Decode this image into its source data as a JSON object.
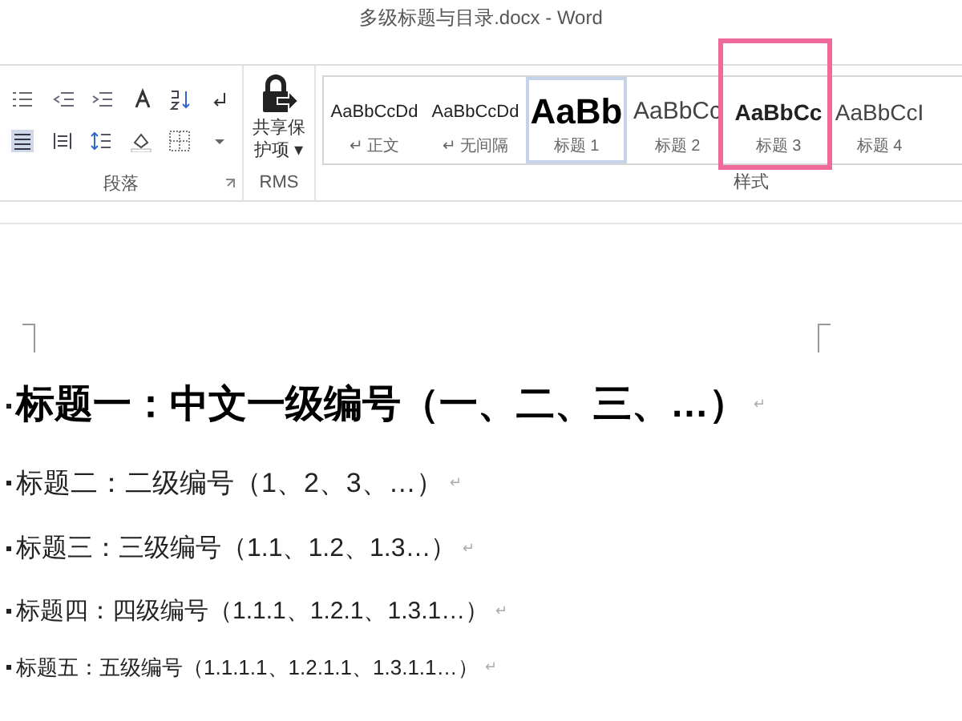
{
  "window": {
    "title": "多级标题与目录.docx - Word"
  },
  "ribbon": {
    "paragraph_group": {
      "label": "段落"
    },
    "rms_group": {
      "button": "共享保护项 ▾",
      "label": "RMS"
    },
    "styles_group": {
      "label": "样式",
      "styles": [
        {
          "preview": "AaBbCcDd",
          "label": "↵ 正文",
          "kind": "body",
          "selected": false,
          "highlighted": false
        },
        {
          "preview": "AaBbCcDd",
          "label": "↵ 无间隔",
          "kind": "body",
          "selected": false,
          "highlighted": false
        },
        {
          "preview": "AaBb",
          "label": "标题 1",
          "kind": "h1",
          "selected": true,
          "highlighted": false
        },
        {
          "preview": "AaBbCc",
          "label": "标题 2",
          "kind": "h2",
          "selected": false,
          "highlighted": false
        },
        {
          "preview": "AaBbCc",
          "label": "标题 3",
          "kind": "h3",
          "selected": false,
          "highlighted": true
        },
        {
          "preview": "AaBbCcI",
          "label": "标题 4",
          "kind": "h4",
          "selected": false,
          "highlighted": false
        }
      ]
    }
  },
  "document": {
    "headings": [
      {
        "kind": "h1",
        "text": "标题一：中文一级编号（一、二、三、…）",
        "mark": "↵"
      },
      {
        "kind": "h2",
        "text": "标题二：二级编号（1、2、3、…）",
        "mark": "↵"
      },
      {
        "kind": "h3",
        "text": "标题三：三级编号（1.1、1.2、1.3…）",
        "mark": "↵"
      },
      {
        "kind": "h4",
        "text": "标题四：四级编号（1.1.1、1.2.1、1.3.1…）",
        "mark": "↵"
      },
      {
        "kind": "h5",
        "text": "标题五：五级编号（1.1.1.1、1.2.1.1、1.3.1.1…）",
        "mark": "↵"
      }
    ]
  }
}
